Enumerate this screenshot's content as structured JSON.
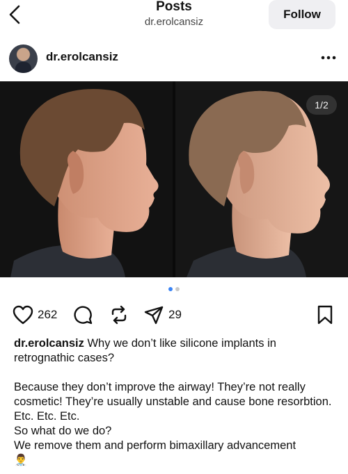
{
  "header": {
    "title": "Posts",
    "subtitle": "dr.erolcansiz",
    "follow_label": "Follow"
  },
  "author": {
    "username": "dr.erolcansiz"
  },
  "media": {
    "page_indicator": "1/2",
    "total_pages": 2,
    "current_page": 1
  },
  "actions": {
    "likes": "262",
    "shares": "29"
  },
  "caption": {
    "username": "dr.erolcansiz",
    "first_line": " Why we don’t like silicone implants in retrognathic cases?",
    "paragraph": "Because they don’t improve the airway! They’re not really cosmetic! They’re usually unstable and cause bone resorbtion. Etc. Etc. Etc.",
    "question": "So what do we do?",
    "answer": "We remove them and perform bimaxillary advancement",
    "emoji": "👨‍⚕️"
  },
  "icons": {
    "back": "chevron-left-icon",
    "more": "more-horizontal-icon",
    "like": "heart-icon",
    "comment": "comment-icon",
    "repost": "repost-icon",
    "share": "send-icon",
    "save": "bookmark-icon"
  },
  "colors": {
    "dot_active": "#3a84f5",
    "dot_inactive": "#c8c8c8",
    "follow_bg": "#efeff2"
  }
}
